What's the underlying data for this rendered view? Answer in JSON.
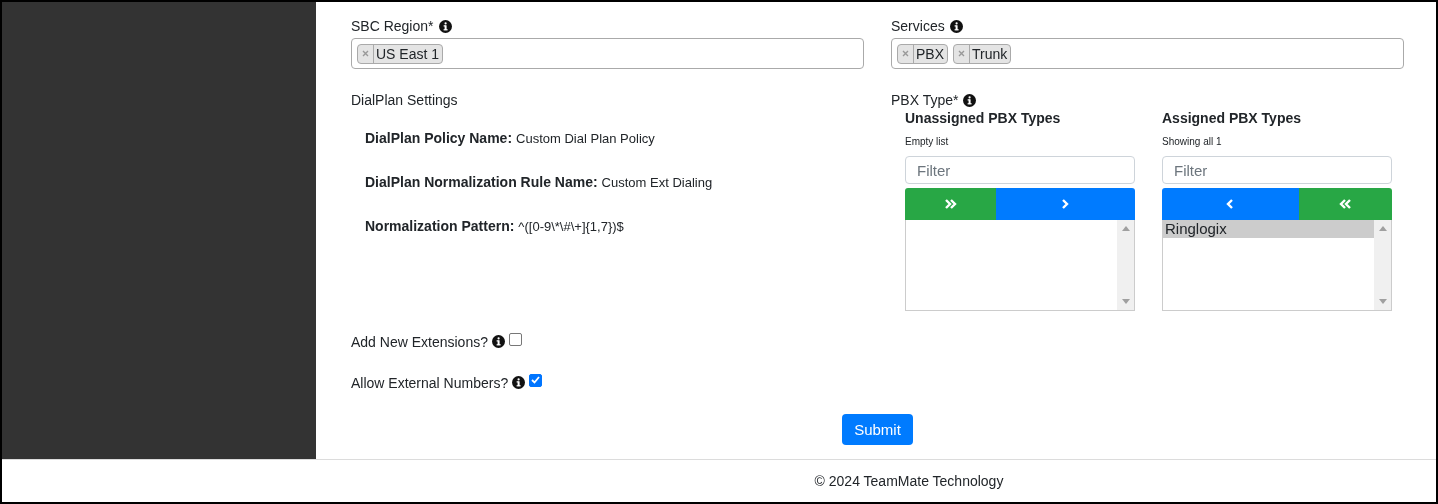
{
  "region": {
    "label": "SBC Region*",
    "tags": [
      "US East 1"
    ]
  },
  "services": {
    "label": "Services",
    "tags": [
      "PBX",
      "Trunk"
    ]
  },
  "dialplan": {
    "title": "DialPlan Settings",
    "rows": [
      {
        "label": "DialPlan Policy Name:",
        "value": "Custom Dial Plan Policy"
      },
      {
        "label": "DialPlan Normalization Rule Name:",
        "value": "Custom Ext Dialing"
      },
      {
        "label": "Normalization Pattern:",
        "value": "^([0-9\\*\\#\\+]{1,7})$"
      }
    ]
  },
  "pbx_type": {
    "label": "PBX Type*",
    "lists": [
      {
        "title": "Unassigned PBX Types",
        "status": "Empty list",
        "filter_placeholder": "Filter",
        "buttons": [
          {
            "kind": "all_right"
          },
          {
            "kind": "right"
          }
        ]
      },
      {
        "title": "Assigned PBX Types",
        "status": "Showing all 1",
        "filter_placeholder": "Filter",
        "buttons": [
          {
            "kind": "left"
          },
          {
            "kind": "all_left"
          }
        ],
        "items": [
          {
            "label": "Ringlogix",
            "selected": true
          }
        ]
      }
    ]
  },
  "options": [
    {
      "label": "Add New Extensions?",
      "checked": false
    },
    {
      "label": "Allow External Numbers?",
      "checked": true
    }
  ],
  "submit": "Submit",
  "footer": "© 2024 TeamMate Technology"
}
